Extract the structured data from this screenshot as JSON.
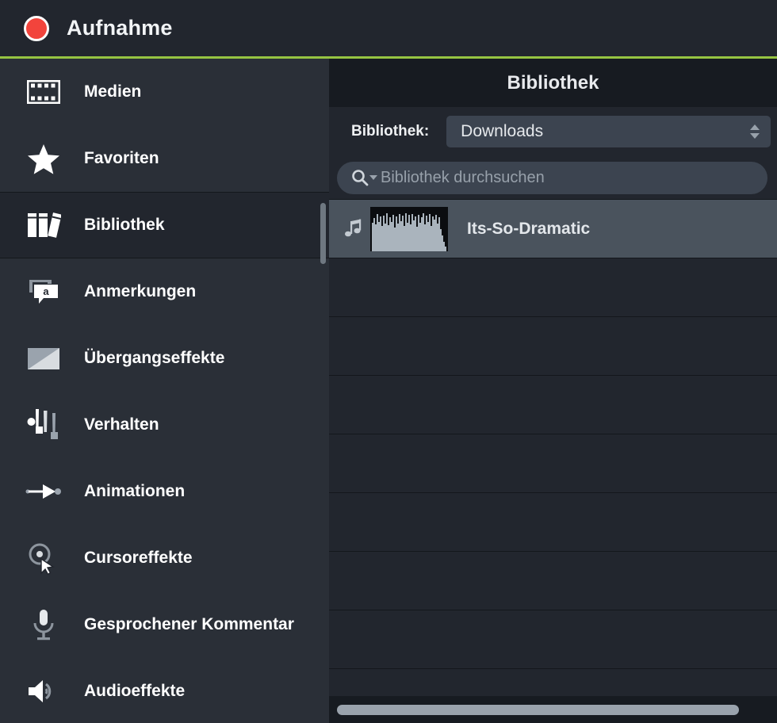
{
  "window": {
    "title": "Aufnahme",
    "record_icon": "record-circle-icon",
    "accent_green": "#96c442",
    "record_red": "#f2443c"
  },
  "sidebar": {
    "items": [
      {
        "label": "Medien",
        "icon": "film-strip-icon",
        "selected": false
      },
      {
        "label": "Favoriten",
        "icon": "star-icon",
        "selected": false
      },
      {
        "label": "Bibliothek",
        "icon": "books-icon",
        "selected": true
      },
      {
        "label": "Anmerkungen",
        "icon": "callout-a-icon",
        "selected": false
      },
      {
        "label": "Übergangseffekte",
        "icon": "transition-icon",
        "selected": false
      },
      {
        "label": "Verhalten",
        "icon": "behaviors-icon",
        "selected": false
      },
      {
        "label": "Animationen",
        "icon": "arrow-keyframe-icon",
        "selected": false
      },
      {
        "label": "Cursoreffekte",
        "icon": "cursor-target-icon",
        "selected": false
      },
      {
        "label": "Gesprochener Kommentar",
        "icon": "microphone-icon",
        "selected": false
      },
      {
        "label": "Audioeffekte",
        "icon": "speaker-icon",
        "selected": false
      }
    ],
    "scrollbar": "sidebar-vertical-scrollbar"
  },
  "panel": {
    "title": "Bibliothek",
    "library_picker": {
      "label": "Bibliothek:",
      "value": "Downloads",
      "stepper_icon": "stepper-arrows-icon"
    },
    "search": {
      "placeholder": "Bibliothek durchsuchen",
      "icon": "search-icon",
      "caret_icon": "chevron-down-icon",
      "value": ""
    },
    "list": {
      "rows": [
        {
          "title": "Its-So-Dramatic",
          "type_icon": "music-note-icon",
          "thumbnail": "audio-waveform-thumbnail",
          "selected": true
        },
        {
          "title": "",
          "type_icon": "",
          "thumbnail": "",
          "selected": false
        },
        {
          "title": "",
          "type_icon": "",
          "thumbnail": "",
          "selected": false
        },
        {
          "title": "",
          "type_icon": "",
          "thumbnail": "",
          "selected": false
        },
        {
          "title": "",
          "type_icon": "",
          "thumbnail": "",
          "selected": false
        },
        {
          "title": "",
          "type_icon": "",
          "thumbnail": "",
          "selected": false
        },
        {
          "title": "",
          "type_icon": "",
          "thumbnail": "",
          "selected": false
        },
        {
          "title": "",
          "type_icon": "",
          "thumbnail": "",
          "selected": false
        }
      ]
    },
    "horizontal_scrollbar": "library-horizontal-scrollbar"
  }
}
